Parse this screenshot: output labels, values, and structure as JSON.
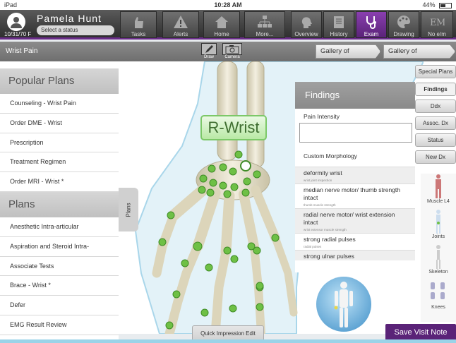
{
  "status_bar": {
    "carrier": "iPad",
    "time": "10:28 AM",
    "battery": "44%"
  },
  "patient": {
    "name": "Pamela  Hunt",
    "dob": "10/31/70 F",
    "status_placeholder": "Select a status"
  },
  "nav_left": [
    {
      "label": "Tasks",
      "icon": "hand-icon"
    },
    {
      "label": "Alerts",
      "icon": "warning-icon"
    },
    {
      "label": "Home",
      "icon": "home-icon"
    },
    {
      "label": "More...",
      "icon": "org-chart-icon"
    }
  ],
  "nav_right": [
    {
      "label": "Overview",
      "icon": "head-icon"
    },
    {
      "label": "History",
      "icon": "book-icon"
    },
    {
      "label": "Exam",
      "icon": "stethoscope-icon"
    },
    {
      "label": "Drawing",
      "icon": "palette-icon"
    },
    {
      "label": "No e/m",
      "icon": "em-icon"
    }
  ],
  "subbar": {
    "title": "Wrist Pain",
    "draw_label": "Draw",
    "camera_label": "Camera",
    "gallery_findings": "Gallery of Findings",
    "gallery_impressions": "Gallery of Impressions"
  },
  "popular_plans": {
    "title": "Popular Plans",
    "items": [
      "Counseling - Wrist Pain",
      "Order DME - Wrist",
      "Prescription",
      "Treatment Regimen",
      "Order MRI - Wrist *"
    ]
  },
  "plans": {
    "title": "Plans",
    "items": [
      "Anesthetic Intra-articular",
      "Aspiration and Steroid Intra-",
      "Associate Tests",
      "Brace - Wrist *",
      "Defer",
      "EMG Result Review"
    ]
  },
  "plans_tab": "Plans",
  "region_label": "R-Wrist",
  "findings": {
    "title": "Findings",
    "pain_label": "Pain Intensity",
    "custom_label": "Custom Morphology",
    "items": [
      {
        "text": "deformity wrist",
        "sub": "wrist joint inspection"
      },
      {
        "text": "median nerve motor/ thumb strength intact",
        "sub": "thumb muscle strength"
      },
      {
        "text": "radial nerve motor/ wrist extension intact",
        "sub": "wrist extensor muscle strength"
      },
      {
        "text": "strong radial pulses",
        "sub": "radial pulses"
      },
      {
        "text": "strong ulnar pulses",
        "sub": ""
      }
    ]
  },
  "right_tabs": [
    "Special Plans",
    "Findings",
    "Ddx",
    "Assoc. Dx",
    "Status",
    "New Dx"
  ],
  "thumbnails": [
    "Muscle L4",
    "Joints",
    "Skeleton",
    "Knees"
  ],
  "quick_edit": "Quick Impression Edit",
  "save_button": "Save Visit Note",
  "colors": {
    "accent": "#5a2378",
    "marker": "#6ec045"
  }
}
